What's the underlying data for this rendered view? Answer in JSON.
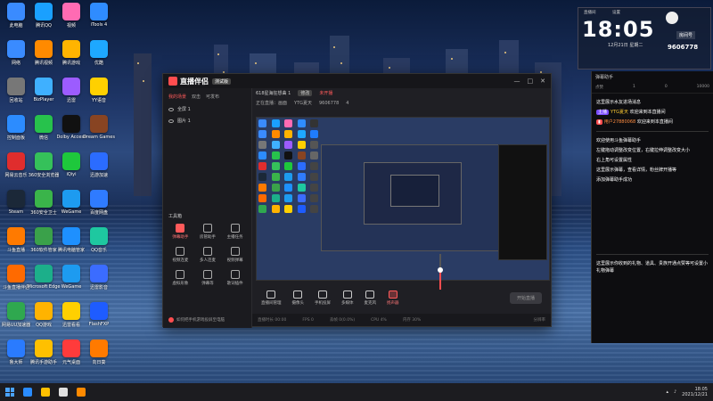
{
  "colors": {
    "accent": "#ff4d4f",
    "chat_badge": "#7a4cff",
    "username": "#ffcc33"
  },
  "desktop_icons": [
    {
      "label": "此电脑",
      "color": "#3a8bff"
    },
    {
      "label": "腾讯QQ",
      "color": "#1aa0ff"
    },
    {
      "label": "视频",
      "color": "#ff6bb3"
    },
    {
      "label": "iTools 4",
      "color": "#2f8cff"
    },
    {
      "label": "",
      "color": "#333333"
    },
    {
      "label": "网络",
      "color": "#3a8bff"
    },
    {
      "label": "腾讯视频",
      "color": "#ff8a00"
    },
    {
      "label": "腾讯游戏",
      "color": "#ffb400"
    },
    {
      "label": "优酷",
      "color": "#1ea8ff"
    },
    {
      "label": "酷狗音乐",
      "color": "#1f7cff"
    },
    {
      "label": "回收站",
      "color": "#777777"
    },
    {
      "label": "BizPlayer",
      "color": "#3fb0ff"
    },
    {
      "label": "迅雷",
      "color": "#9c5cff"
    },
    {
      "label": "YY语音",
      "color": "#ffd000"
    },
    {
      "label": "",
      "color": "#555555"
    },
    {
      "label": "控制面板",
      "color": "#2c8cff"
    },
    {
      "label": "微信",
      "color": "#27c24c"
    },
    {
      "label": "Dolby Access",
      "color": "#111111"
    },
    {
      "label": "Dream Games",
      "color": "#884422"
    },
    {
      "label": "",
      "color": "#666666"
    },
    {
      "label": "网易云音乐",
      "color": "#e02d2d"
    },
    {
      "label": "360安全浏览器",
      "color": "#35c15a"
    },
    {
      "label": "iQiyi",
      "color": "#1ec83c"
    },
    {
      "label": "迅游加速",
      "color": "#2b6cff"
    },
    {
      "label": "",
      "color": "#444444"
    },
    {
      "label": "Steam",
      "color": "#1b2838"
    },
    {
      "label": "360安全卫士",
      "color": "#3ab44a"
    },
    {
      "label": "WeGame",
      "color": "#1d9bf0"
    },
    {
      "label": "百度网盘",
      "color": "#2f7bff"
    },
    {
      "label": "",
      "color": "#444444"
    },
    {
      "label": "斗鱼直播",
      "color": "#ff7a00"
    },
    {
      "label": "360软件管家",
      "color": "#3aa14a"
    },
    {
      "label": "腾讯电脑管家",
      "color": "#1e90ff"
    },
    {
      "label": "QQ音乐",
      "color": "#1ec8a0"
    },
    {
      "label": "",
      "color": "#444444"
    },
    {
      "label": "斗鱼直播伴侣",
      "color": "#ff6a00"
    },
    {
      "label": "Microsoft Edge",
      "color": "#1caf8a"
    },
    {
      "label": "WeGame",
      "color": "#1d9bf0"
    },
    {
      "label": "迅雷影音",
      "color": "#3b6cff"
    },
    {
      "label": "",
      "color": "#444444"
    },
    {
      "label": "网易UU加速器",
      "color": "#2fa84f"
    },
    {
      "label": "QQ游戏",
      "color": "#ffb300"
    },
    {
      "label": "迅雷看看",
      "color": "#ffd000"
    },
    {
      "label": "FlashFXP",
      "color": "#1e5cff"
    },
    {
      "label": "",
      "color": "#444444"
    },
    {
      "label": "鲁大师",
      "color": "#2a7bff"
    },
    {
      "label": "腾讯手游助手",
      "color": "#ffc000"
    },
    {
      "label": "元气桌面",
      "color": "#ff3b3b"
    },
    {
      "label": "向日葵",
      "color": "#ff7a00"
    }
  ],
  "app": {
    "name": "直播伴侣",
    "version": "测试版",
    "tabs": [
      "我的场景",
      "双击",
      "可发布"
    ],
    "scenes": [
      "全屏 1",
      "图片 1"
    ],
    "tools_title": "工具箱",
    "tools": [
      {
        "label": "弹幕助手",
        "hot": true
      },
      {
        "label": "房管助手",
        "hot": false
      },
      {
        "label": "主播任务",
        "hot": false
      },
      {
        "label": "视频连麦",
        "hot": false
      },
      {
        "label": "多人连麦",
        "hot": false
      },
      {
        "label": "视频弹幕",
        "hot": false
      },
      {
        "label": "虚拟形象",
        "hot": false
      },
      {
        "label": "弹幕等",
        "hot": false
      },
      {
        "label": "歌词插件",
        "hot": false
      }
    ],
    "footer_hint": "如何把手机游戏投屏至电脑",
    "room_title": "618星海狂想曲 1",
    "room_tag": "修改",
    "room_status": "未开播",
    "room_sub": "正在直播：画面",
    "room_user": "YTG夏天",
    "room_id": "9606778",
    "room_viewers": "4",
    "bottom_buttons": [
      {
        "label": "直播间管理",
        "red": false
      },
      {
        "label": "摄像头",
        "red": false
      },
      {
        "label": "手机投屏",
        "red": false
      },
      {
        "label": "多媒体",
        "red": false
      },
      {
        "label": "麦克风",
        "red": false
      },
      {
        "label": "扬声器",
        "red": true
      }
    ],
    "start_label": "开始直播",
    "status": [
      "直播时长 00:00",
      "FPS 0",
      "丢帧 0(0.0%)",
      "CPU 4%",
      "内存 30%"
    ],
    "status_right": "分辨率",
    "volume_level": 0.55
  },
  "chat": {
    "title": "弹幕助手",
    "tabs": [
      "点赞",
      "1",
      "0",
      "10000"
    ],
    "messages": [
      {
        "text": "这里展示水友进场消息",
        "badge": "",
        "user": "",
        "kind": "sys"
      },
      {
        "text": "欢迎来到本直播间",
        "badge": "主播",
        "user": "YTG夏天",
        "kind": "badge"
      },
      {
        "text": "欢迎来到本直播间",
        "badge": "",
        "user": "用户27880068",
        "kind": "user"
      }
    ],
    "help": [
      "欢迎使用斗鱼弹幕助手",
      "左键拖动调整改变位置，右键拉伸调整改变大小",
      "右上角可设置属性",
      "这里展示弹幕，查看详情，粉丝牌开播等",
      "添加弹幕助手成功"
    ],
    "gift_hint": "这里展示你收到的礼物、道具、贵族开通点赞等可设置小礼物弹幕"
  },
  "widget": {
    "time": "18:05",
    "date": "12月21日 星期二",
    "room_label": "房间号",
    "room_id": "9606778",
    "header_left": "直播间",
    "header_right": "设置"
  },
  "taskbar": {
    "time": "18:05",
    "date": "2021/12/21"
  }
}
